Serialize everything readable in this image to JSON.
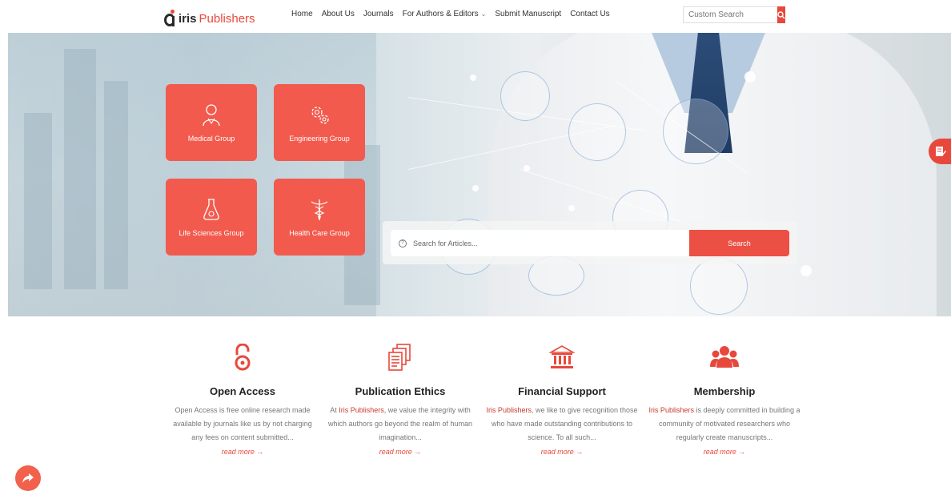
{
  "header": {
    "logo_iris": "iris",
    "logo_publishers": "Publishers",
    "nav": [
      "Home",
      "About Us",
      "Journals",
      "For Authors & Editors",
      "Submit Manuscript",
      "Contact Us"
    ],
    "search_placeholder": "Custom Search"
  },
  "hero": {
    "groups": [
      {
        "label": "Medical Group",
        "icon": "doctor-icon"
      },
      {
        "label": "Engineering Group",
        "icon": "gears-icon"
      },
      {
        "label": "Life Sciences Group",
        "icon": "flask-icon"
      },
      {
        "label": "Health Care Group",
        "icon": "caduceus-icon"
      }
    ],
    "search_placeholder": "Search for Articles...",
    "search_button": "Search"
  },
  "features": [
    {
      "title": "Open Access",
      "icon": "open-lock-icon",
      "brand": "",
      "desc": "Open Access is free online research made available by journals like us by not charging any fees on content submitted...",
      "more": "read more →"
    },
    {
      "title": "Publication Ethics",
      "icon": "documents-icon",
      "brand": "Iris Publishers",
      "pre": "At ",
      "desc": ", we value the integrity with which authors go beyond the realm of human imagination...",
      "more": "read more →"
    },
    {
      "title": "Financial Support",
      "icon": "bank-icon",
      "brand": "Iris Publishers",
      "pre": "",
      "desc": ", we like to give recognition those who have made outstanding contributions to science. To all such...",
      "more": "read more →"
    },
    {
      "title": "Membership",
      "icon": "users-icon",
      "brand": "Iris Publishers",
      "pre": "",
      "desc": " is deeply committed in building a community of motivated researchers who regularly create manuscripts...",
      "more": "read more →"
    }
  ],
  "colors": {
    "accent": "#e8483b",
    "card": "#f25a4d"
  }
}
